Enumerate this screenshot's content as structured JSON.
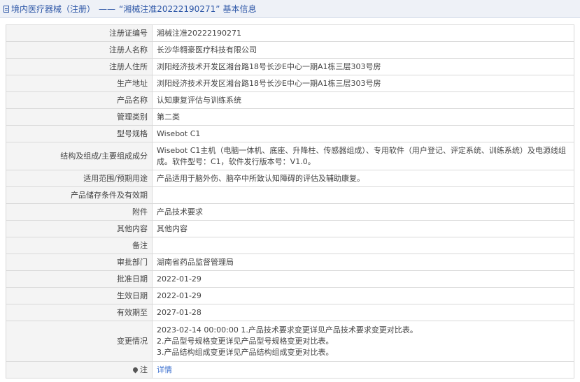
{
  "header": {
    "category": "境内医疗器械（注册）",
    "separator": "——",
    "reg_quoted": "“湘械注准20222190271”",
    "suffix": "基本信息"
  },
  "rows": [
    {
      "label": "注册证编号",
      "value": "湘械注准20222190271"
    },
    {
      "label": "注册人名称",
      "value": "长沙华翱豪医疗科技有限公司"
    },
    {
      "label": "注册人住所",
      "value": "浏阳经济技术开发区湘台路18号长沙E中心一期A1栋三层303号房"
    },
    {
      "label": "生产地址",
      "value": "浏阳经济技术开发区湘台路18号长沙E中心一期A1栋三层303号房"
    },
    {
      "label": "产品名称",
      "value": "认知康复评估与训练系统"
    },
    {
      "label": "管理类别",
      "value": "第二类"
    },
    {
      "label": "型号规格",
      "value": "Wisebot C1"
    },
    {
      "label": "结构及组成/主要组成成分",
      "value": "Wisebot C1主机（电脑一体机、底座、升降柱、传感器组成）、专用软件（用户登记、评定系统、训练系统）及电源线组成。软件型号：C1，软件发行版本号：V1.0。"
    },
    {
      "label": "适用范围/预期用途",
      "value": "产品适用于脑外伤、脑卒中所致认知障碍的评估及辅助康复。"
    },
    {
      "label": "产品储存条件及有效期",
      "value": ""
    },
    {
      "label": "附件",
      "value": "产品技术要求"
    },
    {
      "label": "其他内容",
      "value": "其他内容"
    },
    {
      "label": "备注",
      "value": ""
    },
    {
      "label": "审批部门",
      "value": "湖南省药品监督管理局"
    },
    {
      "label": "批准日期",
      "value": "2022-01-29"
    },
    {
      "label": "生效日期",
      "value": "2022-01-29"
    },
    {
      "label": "有效期至",
      "value": "2027-01-28"
    }
  ],
  "changes": {
    "label": "变更情况",
    "lines": [
      "2023-02-14 00:00:00 1.产品技术要求变更详见产品技术要求变更对比表。",
      "2.产品型号规格变更详见产品型号规格变更对比表。",
      "3.产品结构组成变更详见产品结构组成变更对比表。"
    ]
  },
  "footer": {
    "label": "注",
    "icon": "location-pin-icon",
    "link": "详情"
  }
}
